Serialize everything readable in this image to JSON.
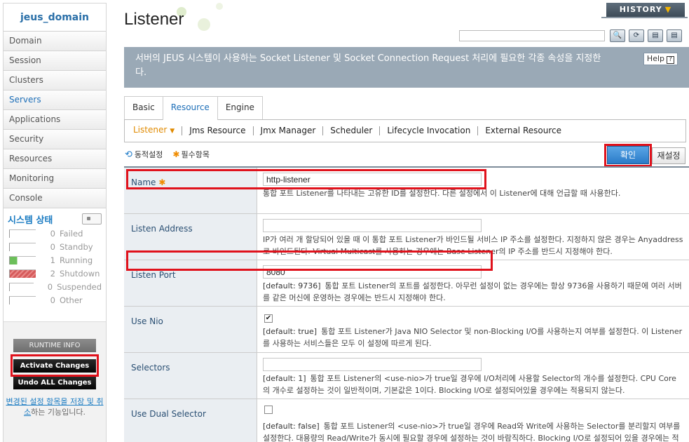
{
  "sidebar": {
    "domain_title": "jeus_domain",
    "nav_items": [
      {
        "label": "Domain"
      },
      {
        "label": "Session"
      },
      {
        "label": "Clusters"
      },
      {
        "label": "Servers",
        "active": true
      },
      {
        "label": "Applications"
      },
      {
        "label": "Security"
      },
      {
        "label": "Resources"
      },
      {
        "label": "Monitoring"
      },
      {
        "label": "Console"
      }
    ],
    "system_status": {
      "title": "시스템 상태",
      "rows": [
        {
          "count": "0",
          "label": "Failed"
        },
        {
          "count": "0",
          "label": "Standby"
        },
        {
          "count": "1",
          "label": "Running"
        },
        {
          "count": "2",
          "label": "Shutdown"
        },
        {
          "count": "0",
          "label": "Suspended"
        },
        {
          "count": "0",
          "label": "Other"
        }
      ]
    },
    "runtime_info_label": "RUNTIME INFO",
    "activate_label": "Activate Changes",
    "undo_label": "Undo ALL Changes",
    "note_link": "변경된 설정 항목을 저장 및 취소",
    "note_rest": "하는 기능입니다."
  },
  "header": {
    "title": "Listener",
    "history_label": "HISTORY",
    "search_placeholder": "",
    "toolbar": [
      "search-icon",
      "refresh-icon",
      "xml-export-icon",
      "xml-import-icon"
    ]
  },
  "banner": {
    "text": "서버의 JEUS 시스템이 사용하는 Socket Listener 및 Socket Connection Request 처리에 필요한 각종 속성을 지정한다.",
    "help_label": "Help"
  },
  "tabs": [
    {
      "label": "Basic"
    },
    {
      "label": "Resource",
      "active": true
    },
    {
      "label": "Engine"
    }
  ],
  "sub_tabs": [
    {
      "label": "Listener",
      "active": true
    },
    {
      "label": "Jms Resource"
    },
    {
      "label": "Jmx Manager"
    },
    {
      "label": "Scheduler"
    },
    {
      "label": "Lifecycle Invocation"
    },
    {
      "label": "External Resource"
    }
  ],
  "legend": {
    "dynamic": "동적설정",
    "required": "필수항목"
  },
  "buttons": {
    "ok": "확인",
    "reset": "재설정"
  },
  "form": {
    "name": {
      "label": "Name",
      "value": "http-listener",
      "help": "통합 포트 Listener를 나타내는 고유한 ID를 설정한다. 다른 설정에서 이 Listener에 대해 언급할 때 사용한다."
    },
    "listen_address": {
      "label": "Listen Address",
      "value": "",
      "help": "IP가 여러 개 할당되어 있을 때 이 통합 포트 Listener가 바인드될 서비스 IP 주소를 설정한다. 지정하지 않은 경우는 Anyaddress로 바인드된다. Virtual Multicast를 사용하는 경우에는 Base Listener의 IP 주소를 반드시 지정해야 한다."
    },
    "listen_port": {
      "label": "Listen Port",
      "value": "8080",
      "default": "[default: 9736]",
      "help": "통합 포트 Listener의 포트를 설정한다. 아무런 설정이 없는 경우에는 항상 9736을 사용하기 때문에 여러 서버를 같은 머신에 운영하는 경우에는 반드시 지정해야 한다."
    },
    "use_nio": {
      "label": "Use Nio",
      "checked": "✔",
      "default": "[default: true]",
      "help": "통합 포트 Listener가 Java NIO Selector 및 non-Blocking I/O를 사용하는지 여부를 설정한다. 이 Listener를 사용하는 서비스들은 모두 이 설정에 따르게 된다."
    },
    "selectors": {
      "label": "Selectors",
      "value": "",
      "default": "[default: 1]",
      "help": "통합 포트 Listener의 <use-nio>가 true일 경우에 I/O처리에 사용할 Selector의 개수를 설정한다. CPU Core의 개수로 설정하는 것이 일반적이며, 기본값은 1이다. Blocking I/O로 설정되어있을 경우에는 적용되지 않는다."
    },
    "use_dual_selector": {
      "label": "Use Dual Selector",
      "checked": "",
      "default": "[default: false]",
      "help": "통합 포트 Listener의 <use-nio>가 true일 경우에 Read와 Write에 사용하는 Selector를 분리할지 여부를 설정한다. 대용량의 Read/Write가 동시에 필요할 경우에 설정하는 것이 바람직하다. Blocking I/O로 설정되어 있을 경우에는 적용되지 않는다."
    }
  }
}
